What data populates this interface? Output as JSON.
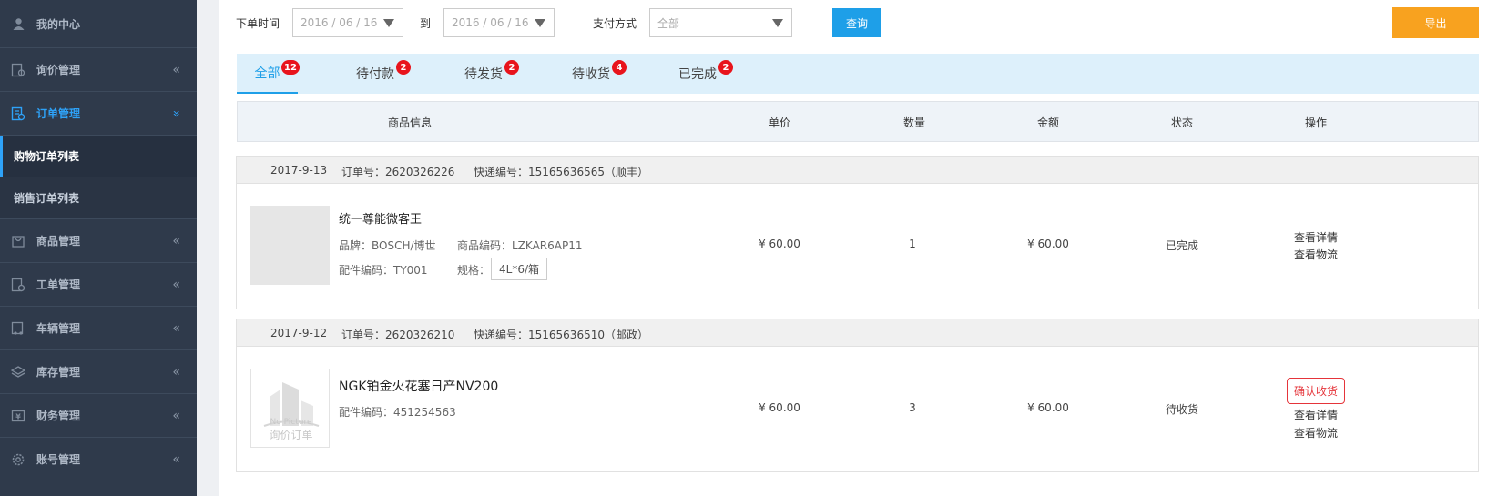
{
  "sidebar": {
    "items": [
      {
        "label": "我的中心",
        "icon": "user-icon",
        "chevron": ""
      },
      {
        "label": "询价管理",
        "icon": "inquiry-icon",
        "chevron": "«"
      },
      {
        "label": "订单管理",
        "icon": "order-icon",
        "chevron": "»",
        "active": true
      },
      {
        "label": "商品管理",
        "icon": "bag-icon",
        "chevron": "«"
      },
      {
        "label": "工单管理",
        "icon": "workorder-icon",
        "chevron": "«"
      },
      {
        "label": "车辆管理",
        "icon": "vehicle-icon",
        "chevron": "«"
      },
      {
        "label": "库存管理",
        "icon": "layers-icon",
        "chevron": "«"
      },
      {
        "label": "财务管理",
        "icon": "finance-icon",
        "chevron": "«"
      },
      {
        "label": "账号管理",
        "icon": "gear-icon",
        "chevron": "«"
      }
    ],
    "subitems": [
      "购物订单列表",
      "销售订单列表"
    ]
  },
  "filter": {
    "order_time_label": "下单时间",
    "date_from": "2016 / 06 / 16",
    "to_label": "到",
    "date_to": "2016 / 06 / 16",
    "payment_label": "支付方式",
    "payment_value": "全部",
    "query_label": "查询",
    "export_label": "导出"
  },
  "tabs": [
    {
      "label": "全部",
      "count": "12"
    },
    {
      "label": "待付款",
      "count": "2"
    },
    {
      "label": "待发货",
      "count": "2"
    },
    {
      "label": "待收货",
      "count": "4"
    },
    {
      "label": "已完成",
      "count": "2"
    }
  ],
  "table_headers": [
    "商品信息",
    "单价",
    "数量",
    "金额",
    "状态",
    "操作"
  ],
  "orders": [
    {
      "date": "2017-9-13",
      "order_no": "订单号：2620326226",
      "express": "快递编号：15165636565（顺丰）",
      "product_name": "统一尊能微客王",
      "brand": "品牌：BOSCH/博世",
      "product_code": "商品编码：LZKAR6AP11",
      "part_code": "配件编码：TY001",
      "spec_label": "规格：",
      "spec_value": "4L*6/箱",
      "unit_price": "¥ 60.00",
      "quantity": "1",
      "amount": "¥ 60.00",
      "status": "已完成",
      "actions": [
        "查看详情",
        "查看物流"
      ]
    },
    {
      "date": "2017-9-12",
      "order_no": "订单号：2620326210",
      "express": "快递编号：15165636510（邮政）",
      "product_name": "NGK铂金火花塞日产NV200",
      "part_code": "配件编码：451254563",
      "nopic_en": "No Picture",
      "nopic_cn": "询价订单",
      "unit_price": "¥ 60.00",
      "quantity": "3",
      "amount": "¥ 60.00",
      "status": "待收货",
      "confirm_label": "确认收货",
      "actions": [
        "查看详情",
        "查看物流"
      ]
    }
  ],
  "colors": {
    "sidebar_bg": "#2f3a4b",
    "accent_blue": "#1e9fe8",
    "export_orange": "#f8a21f",
    "badge_red": "#e8141c"
  }
}
